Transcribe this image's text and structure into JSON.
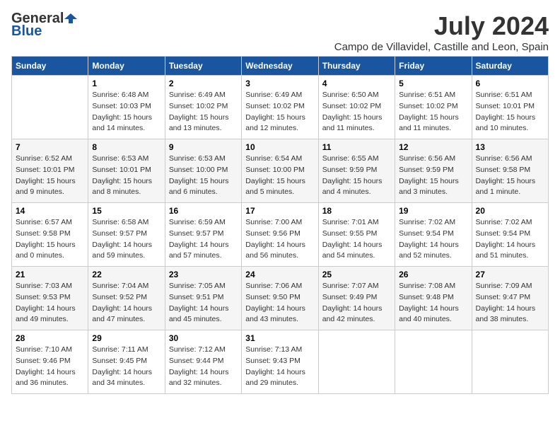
{
  "logo": {
    "general": "General",
    "blue": "Blue"
  },
  "title": "July 2024",
  "subtitle": "Campo de Villavidel, Castille and Leon, Spain",
  "days_of_week": [
    "Sunday",
    "Monday",
    "Tuesday",
    "Wednesday",
    "Thursday",
    "Friday",
    "Saturday"
  ],
  "weeks": [
    [
      {
        "day": "",
        "info": ""
      },
      {
        "day": "1",
        "info": "Sunrise: 6:48 AM\nSunset: 10:03 PM\nDaylight: 15 hours\nand 14 minutes."
      },
      {
        "day": "2",
        "info": "Sunrise: 6:49 AM\nSunset: 10:02 PM\nDaylight: 15 hours\nand 13 minutes."
      },
      {
        "day": "3",
        "info": "Sunrise: 6:49 AM\nSunset: 10:02 PM\nDaylight: 15 hours\nand 12 minutes."
      },
      {
        "day": "4",
        "info": "Sunrise: 6:50 AM\nSunset: 10:02 PM\nDaylight: 15 hours\nand 11 minutes."
      },
      {
        "day": "5",
        "info": "Sunrise: 6:51 AM\nSunset: 10:02 PM\nDaylight: 15 hours\nand 11 minutes."
      },
      {
        "day": "6",
        "info": "Sunrise: 6:51 AM\nSunset: 10:01 PM\nDaylight: 15 hours\nand 10 minutes."
      }
    ],
    [
      {
        "day": "7",
        "info": "Sunrise: 6:52 AM\nSunset: 10:01 PM\nDaylight: 15 hours\nand 9 minutes."
      },
      {
        "day": "8",
        "info": "Sunrise: 6:53 AM\nSunset: 10:01 PM\nDaylight: 15 hours\nand 8 minutes."
      },
      {
        "day": "9",
        "info": "Sunrise: 6:53 AM\nSunset: 10:00 PM\nDaylight: 15 hours\nand 6 minutes."
      },
      {
        "day": "10",
        "info": "Sunrise: 6:54 AM\nSunset: 10:00 PM\nDaylight: 15 hours\nand 5 minutes."
      },
      {
        "day": "11",
        "info": "Sunrise: 6:55 AM\nSunset: 9:59 PM\nDaylight: 15 hours\nand 4 minutes."
      },
      {
        "day": "12",
        "info": "Sunrise: 6:56 AM\nSunset: 9:59 PM\nDaylight: 15 hours\nand 3 minutes."
      },
      {
        "day": "13",
        "info": "Sunrise: 6:56 AM\nSunset: 9:58 PM\nDaylight: 15 hours\nand 1 minute."
      }
    ],
    [
      {
        "day": "14",
        "info": "Sunrise: 6:57 AM\nSunset: 9:58 PM\nDaylight: 15 hours\nand 0 minutes."
      },
      {
        "day": "15",
        "info": "Sunrise: 6:58 AM\nSunset: 9:57 PM\nDaylight: 14 hours\nand 59 minutes."
      },
      {
        "day": "16",
        "info": "Sunrise: 6:59 AM\nSunset: 9:57 PM\nDaylight: 14 hours\nand 57 minutes."
      },
      {
        "day": "17",
        "info": "Sunrise: 7:00 AM\nSunset: 9:56 PM\nDaylight: 14 hours\nand 56 minutes."
      },
      {
        "day": "18",
        "info": "Sunrise: 7:01 AM\nSunset: 9:55 PM\nDaylight: 14 hours\nand 54 minutes."
      },
      {
        "day": "19",
        "info": "Sunrise: 7:02 AM\nSunset: 9:54 PM\nDaylight: 14 hours\nand 52 minutes."
      },
      {
        "day": "20",
        "info": "Sunrise: 7:02 AM\nSunset: 9:54 PM\nDaylight: 14 hours\nand 51 minutes."
      }
    ],
    [
      {
        "day": "21",
        "info": "Sunrise: 7:03 AM\nSunset: 9:53 PM\nDaylight: 14 hours\nand 49 minutes."
      },
      {
        "day": "22",
        "info": "Sunrise: 7:04 AM\nSunset: 9:52 PM\nDaylight: 14 hours\nand 47 minutes."
      },
      {
        "day": "23",
        "info": "Sunrise: 7:05 AM\nSunset: 9:51 PM\nDaylight: 14 hours\nand 45 minutes."
      },
      {
        "day": "24",
        "info": "Sunrise: 7:06 AM\nSunset: 9:50 PM\nDaylight: 14 hours\nand 43 minutes."
      },
      {
        "day": "25",
        "info": "Sunrise: 7:07 AM\nSunset: 9:49 PM\nDaylight: 14 hours\nand 42 minutes."
      },
      {
        "day": "26",
        "info": "Sunrise: 7:08 AM\nSunset: 9:48 PM\nDaylight: 14 hours\nand 40 minutes."
      },
      {
        "day": "27",
        "info": "Sunrise: 7:09 AM\nSunset: 9:47 PM\nDaylight: 14 hours\nand 38 minutes."
      }
    ],
    [
      {
        "day": "28",
        "info": "Sunrise: 7:10 AM\nSunset: 9:46 PM\nDaylight: 14 hours\nand 36 minutes."
      },
      {
        "day": "29",
        "info": "Sunrise: 7:11 AM\nSunset: 9:45 PM\nDaylight: 14 hours\nand 34 minutes."
      },
      {
        "day": "30",
        "info": "Sunrise: 7:12 AM\nSunset: 9:44 PM\nDaylight: 14 hours\nand 32 minutes."
      },
      {
        "day": "31",
        "info": "Sunrise: 7:13 AM\nSunset: 9:43 PM\nDaylight: 14 hours\nand 29 minutes."
      },
      {
        "day": "",
        "info": ""
      },
      {
        "day": "",
        "info": ""
      },
      {
        "day": "",
        "info": ""
      }
    ]
  ]
}
